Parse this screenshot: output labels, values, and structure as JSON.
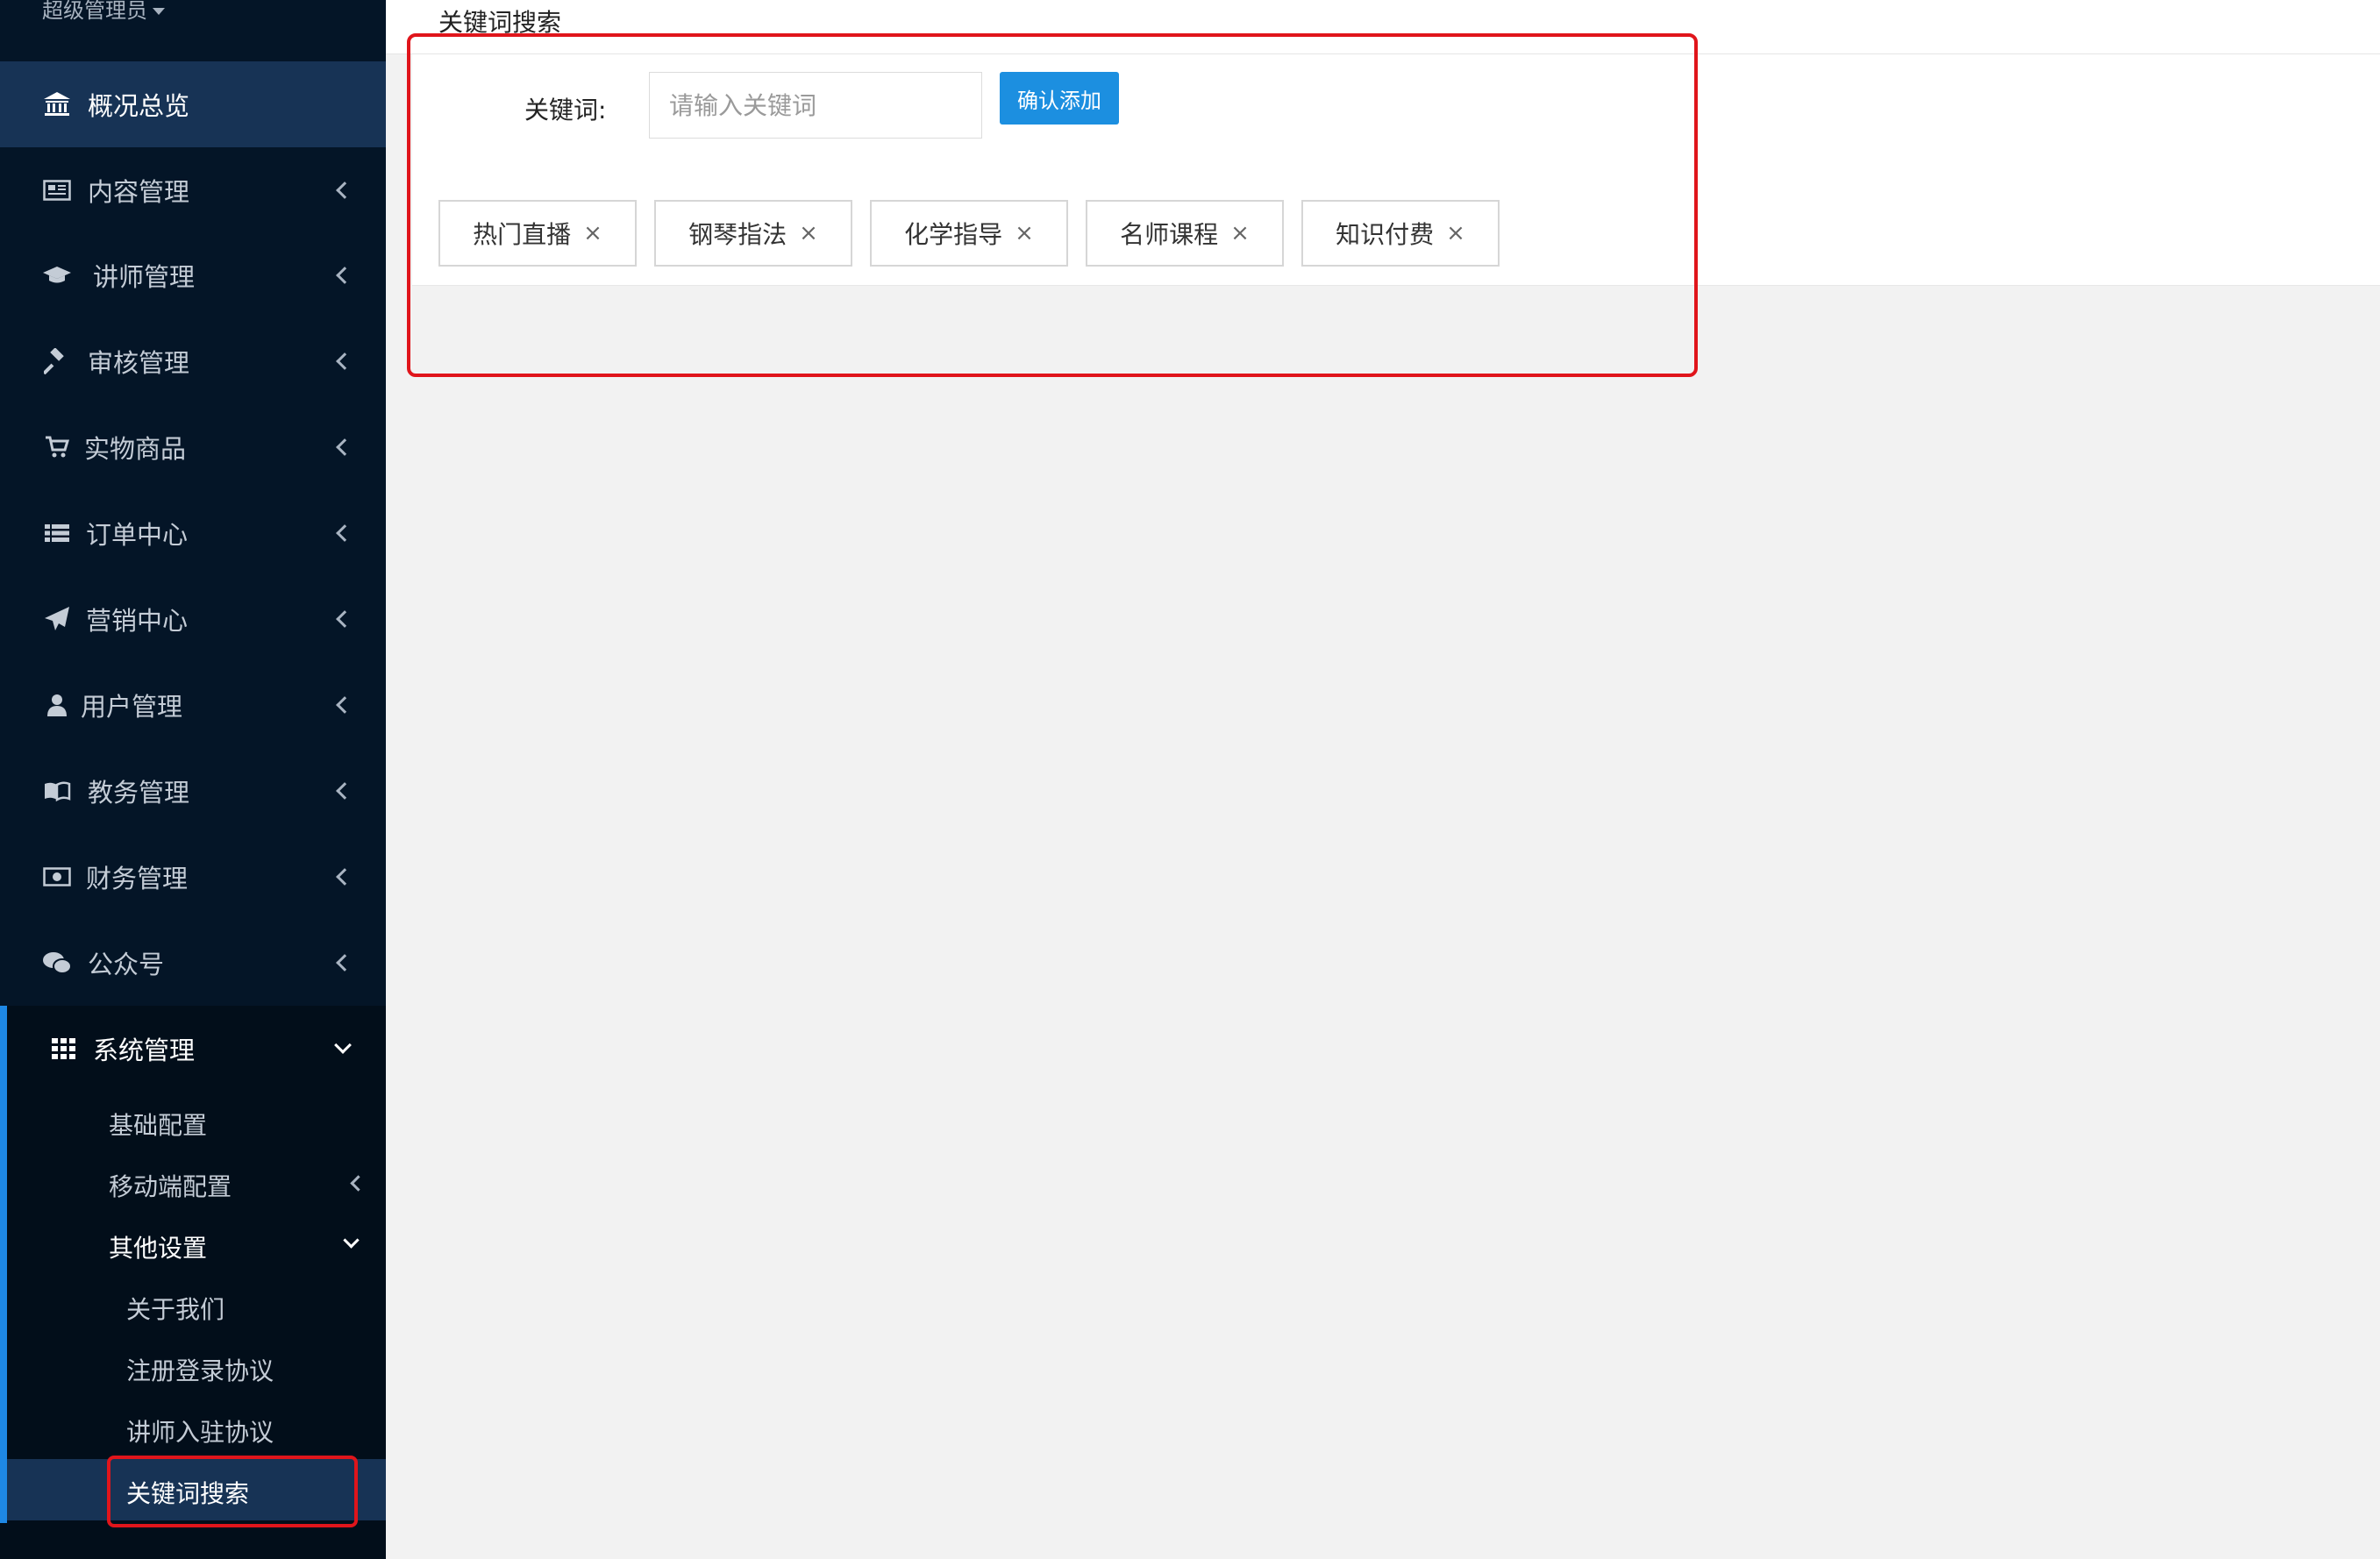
{
  "sidebar": {
    "user": "超级管理员",
    "items": [
      {
        "label": "概况总览",
        "icon": "bank-icon"
      },
      {
        "label": "内容管理",
        "icon": "newspaper-icon"
      },
      {
        "label": "讲师管理",
        "icon": "graduation-cap-icon"
      },
      {
        "label": "审核管理",
        "icon": "gavel-icon"
      },
      {
        "label": "实物商品",
        "icon": "cart-icon"
      },
      {
        "label": "订单中心",
        "icon": "list-icon"
      },
      {
        "label": "营销中心",
        "icon": "paper-plane-icon"
      },
      {
        "label": "用户管理",
        "icon": "user-icon"
      },
      {
        "label": "教务管理",
        "icon": "book-icon"
      },
      {
        "label": "财务管理",
        "icon": "money-icon"
      },
      {
        "label": "公众号",
        "icon": "wechat-icon"
      },
      {
        "label": "系统管理",
        "icon": "grid-icon"
      }
    ],
    "sub": {
      "basic": "基础配置",
      "mobile": "移动端配置",
      "other": "其他设置",
      "about": "关于我们",
      "register": "注册登录协议",
      "lecturer": "讲师入驻协议",
      "keyword": "关键词搜索"
    }
  },
  "main": {
    "title": "关键词搜索",
    "keyword_label": "关键词:",
    "input_placeholder": "请输入关键词",
    "input_value": "",
    "add_button": "确认添加",
    "tags": [
      "热门直播",
      "钢琴指法",
      "化学指导",
      "名师课程",
      "知识付费"
    ],
    "tag_close": "×"
  },
  "colors": {
    "sidebar_bg": "#041527",
    "active_bg": "#173355",
    "accent": "#1c8fe0",
    "highlight_box": "#e0151b"
  }
}
